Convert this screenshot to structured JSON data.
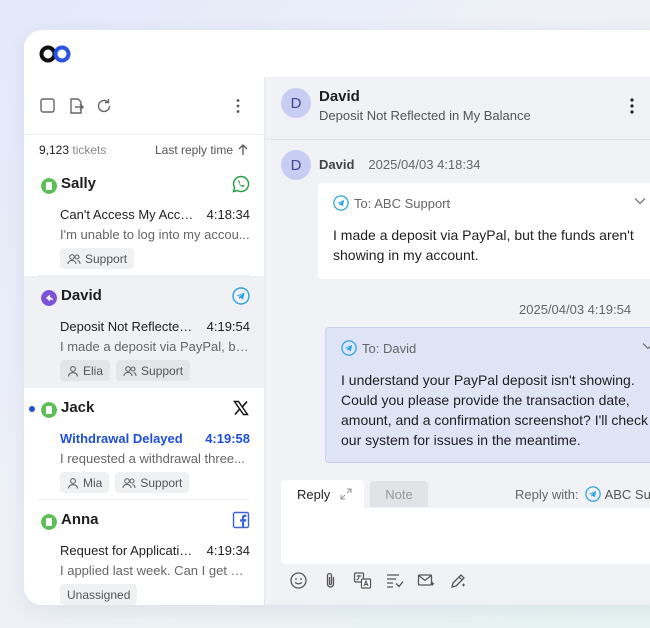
{
  "app": {
    "logo": "brand-logo",
    "accent": "#1e4fd6"
  },
  "sidebar": {
    "ticket_count": "9,123",
    "ticket_count_suffix": "tickets",
    "sort_label": "Last reply time",
    "tickets": [
      {
        "name": "Sally",
        "status_color": "#5bbf55",
        "channel": "whatsapp-icon",
        "subject": "Can't Access My Acco...",
        "time": "4:18:34",
        "preview": "I'm unable to log into my accou...",
        "tags": [
          "Support"
        ]
      },
      {
        "name": "David",
        "status_color": "#7b52d9",
        "channel": "telegram-icon",
        "subject": "Deposit Not Reflected...",
        "time": "4:19:54",
        "preview": "I made a deposit via PayPal, bu...",
        "tags": [
          "Elia",
          "Support"
        ]
      },
      {
        "name": "Jack",
        "status_color": "#5bbf55",
        "channel": "x-icon",
        "subject": "Withdrawal Delayed",
        "time": "4:19:58",
        "preview": "I requested a withdrawal three...",
        "tags": [
          "Mia",
          "Support"
        ]
      },
      {
        "name": "Anna",
        "status_color": "#5bbf55",
        "channel": "facebook-icon",
        "subject": "Request for Applicatio...",
        "time": "4:19:34",
        "preview": "I applied last week. Can I get an...",
        "tags": [
          "Unassigned"
        ]
      }
    ]
  },
  "conversation": {
    "avatar_letter": "D",
    "name": "David",
    "subject": "Deposit Not Reflected in My Balance",
    "incoming": {
      "sender": "David",
      "timestamp": "2025/04/03 4:18:34",
      "to": "To: ABC Support",
      "text": "I made a deposit via PayPal, but the funds aren't showing in my account."
    },
    "outgoing": {
      "timestamp": "2025/04/03 4:19:54",
      "to": "To: David",
      "text": "I understand your PayPal deposit isn't showing. Could you please provide the transaction date, amount, and a confirmation screenshot? I'll check our system for issues in the meantime."
    }
  },
  "composer": {
    "reply_tab": "Reply",
    "note_tab": "Note",
    "reply_with_label": "Reply with:",
    "reply_channel": "ABC Support"
  }
}
